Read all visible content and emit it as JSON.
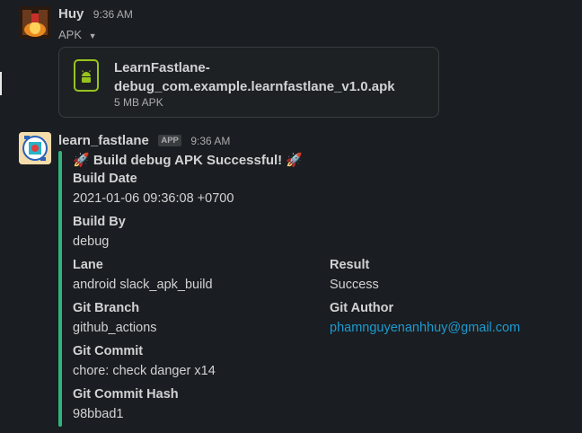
{
  "message1": {
    "author": "Huy",
    "time": "9:36 AM",
    "file_section_label": "APK",
    "file": {
      "name_line1": "LearnFastlane-",
      "name_line2": "debug_com.example.learnfastlane_v1.0.apk",
      "meta": "5 MB APK",
      "icon": "android-icon"
    }
  },
  "message2": {
    "author": "learn_fastlane",
    "badge": "APP",
    "time": "9:36 AM",
    "accent_color": "#2eb67d",
    "title_emoji": "🚀",
    "title": "Build debug APK Successful!",
    "fields": {
      "build_date_title": "Build Date",
      "build_date_value": "2021-01-06 09:36:08 +0700",
      "build_by_title": "Build By",
      "build_by_value": "debug",
      "lane_title": "Lane",
      "lane_value": "android slack_apk_build",
      "result_title": "Result",
      "result_value": "Success",
      "branch_title": "Git Branch",
      "branch_value": "github_actions",
      "author_title": "Git Author",
      "author_value": "phamnguyenanhhuy@gmail.com",
      "commit_title": "Git Commit",
      "commit_value": "chore: check danger x14",
      "hash_title": "Git Commit Hash",
      "hash_value": "98bbad1"
    }
  }
}
